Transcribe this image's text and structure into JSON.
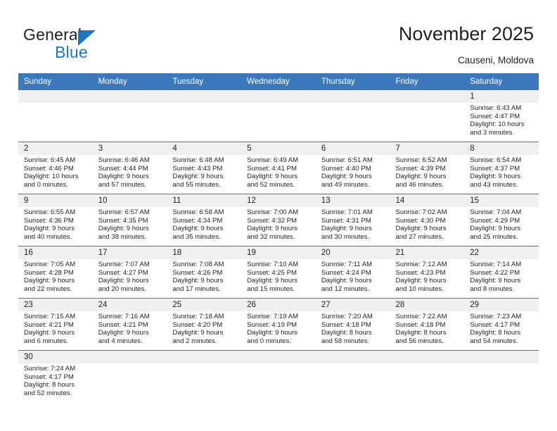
{
  "brand": {
    "name_part1": "General",
    "name_part2": "Blue",
    "accent_color": "#1f76bc"
  },
  "header": {
    "title": "November 2025",
    "subtitle": "Causeni, Moldova"
  },
  "calendar": {
    "header_bg": "#3b78bc",
    "daynum_bg": "#f0f0f0",
    "weekdays": [
      "Sunday",
      "Monday",
      "Tuesday",
      "Wednesday",
      "Thursday",
      "Friday",
      "Saturday"
    ],
    "weeks": [
      [
        {
          "blank": true
        },
        {
          "blank": true
        },
        {
          "blank": true
        },
        {
          "blank": true
        },
        {
          "blank": true
        },
        {
          "blank": true
        },
        {
          "day": "1",
          "sunrise": "Sunrise: 6:43 AM",
          "sunset": "Sunset: 4:47 PM",
          "daylight1": "Daylight: 10 hours",
          "daylight2": "and 3 minutes."
        }
      ],
      [
        {
          "day": "2",
          "sunrise": "Sunrise: 6:45 AM",
          "sunset": "Sunset: 4:46 PM",
          "daylight1": "Daylight: 10 hours",
          "daylight2": "and 0 minutes."
        },
        {
          "day": "3",
          "sunrise": "Sunrise: 6:46 AM",
          "sunset": "Sunset: 4:44 PM",
          "daylight1": "Daylight: 9 hours",
          "daylight2": "and 57 minutes."
        },
        {
          "day": "4",
          "sunrise": "Sunrise: 6:48 AM",
          "sunset": "Sunset: 4:43 PM",
          "daylight1": "Daylight: 9 hours",
          "daylight2": "and 55 minutes."
        },
        {
          "day": "5",
          "sunrise": "Sunrise: 6:49 AM",
          "sunset": "Sunset: 4:41 PM",
          "daylight1": "Daylight: 9 hours",
          "daylight2": "and 52 minutes."
        },
        {
          "day": "6",
          "sunrise": "Sunrise: 6:51 AM",
          "sunset": "Sunset: 4:40 PM",
          "daylight1": "Daylight: 9 hours",
          "daylight2": "and 49 minutes."
        },
        {
          "day": "7",
          "sunrise": "Sunrise: 6:52 AM",
          "sunset": "Sunset: 4:39 PM",
          "daylight1": "Daylight: 9 hours",
          "daylight2": "and 46 minutes."
        },
        {
          "day": "8",
          "sunrise": "Sunrise: 6:54 AM",
          "sunset": "Sunset: 4:37 PM",
          "daylight1": "Daylight: 9 hours",
          "daylight2": "and 43 minutes."
        }
      ],
      [
        {
          "day": "9",
          "sunrise": "Sunrise: 6:55 AM",
          "sunset": "Sunset: 4:36 PM",
          "daylight1": "Daylight: 9 hours",
          "daylight2": "and 40 minutes."
        },
        {
          "day": "10",
          "sunrise": "Sunrise: 6:57 AM",
          "sunset": "Sunset: 4:35 PM",
          "daylight1": "Daylight: 9 hours",
          "daylight2": "and 38 minutes."
        },
        {
          "day": "11",
          "sunrise": "Sunrise: 6:58 AM",
          "sunset": "Sunset: 4:34 PM",
          "daylight1": "Daylight: 9 hours",
          "daylight2": "and 35 minutes."
        },
        {
          "day": "12",
          "sunrise": "Sunrise: 7:00 AM",
          "sunset": "Sunset: 4:32 PM",
          "daylight1": "Daylight: 9 hours",
          "daylight2": "and 32 minutes."
        },
        {
          "day": "13",
          "sunrise": "Sunrise: 7:01 AM",
          "sunset": "Sunset: 4:31 PM",
          "daylight1": "Daylight: 9 hours",
          "daylight2": "and 30 minutes."
        },
        {
          "day": "14",
          "sunrise": "Sunrise: 7:02 AM",
          "sunset": "Sunset: 4:30 PM",
          "daylight1": "Daylight: 9 hours",
          "daylight2": "and 27 minutes."
        },
        {
          "day": "15",
          "sunrise": "Sunrise: 7:04 AM",
          "sunset": "Sunset: 4:29 PM",
          "daylight1": "Daylight: 9 hours",
          "daylight2": "and 25 minutes."
        }
      ],
      [
        {
          "day": "16",
          "sunrise": "Sunrise: 7:05 AM",
          "sunset": "Sunset: 4:28 PM",
          "daylight1": "Daylight: 9 hours",
          "daylight2": "and 22 minutes."
        },
        {
          "day": "17",
          "sunrise": "Sunrise: 7:07 AM",
          "sunset": "Sunset: 4:27 PM",
          "daylight1": "Daylight: 9 hours",
          "daylight2": "and 20 minutes."
        },
        {
          "day": "18",
          "sunrise": "Sunrise: 7:08 AM",
          "sunset": "Sunset: 4:26 PM",
          "daylight1": "Daylight: 9 hours",
          "daylight2": "and 17 minutes."
        },
        {
          "day": "19",
          "sunrise": "Sunrise: 7:10 AM",
          "sunset": "Sunset: 4:25 PM",
          "daylight1": "Daylight: 9 hours",
          "daylight2": "and 15 minutes."
        },
        {
          "day": "20",
          "sunrise": "Sunrise: 7:11 AM",
          "sunset": "Sunset: 4:24 PM",
          "daylight1": "Daylight: 9 hours",
          "daylight2": "and 12 minutes."
        },
        {
          "day": "21",
          "sunrise": "Sunrise: 7:12 AM",
          "sunset": "Sunset: 4:23 PM",
          "daylight1": "Daylight: 9 hours",
          "daylight2": "and 10 minutes."
        },
        {
          "day": "22",
          "sunrise": "Sunrise: 7:14 AM",
          "sunset": "Sunset: 4:22 PM",
          "daylight1": "Daylight: 9 hours",
          "daylight2": "and 8 minutes."
        }
      ],
      [
        {
          "day": "23",
          "sunrise": "Sunrise: 7:15 AM",
          "sunset": "Sunset: 4:21 PM",
          "daylight1": "Daylight: 9 hours",
          "daylight2": "and 6 minutes."
        },
        {
          "day": "24",
          "sunrise": "Sunrise: 7:16 AM",
          "sunset": "Sunset: 4:21 PM",
          "daylight1": "Daylight: 9 hours",
          "daylight2": "and 4 minutes."
        },
        {
          "day": "25",
          "sunrise": "Sunrise: 7:18 AM",
          "sunset": "Sunset: 4:20 PM",
          "daylight1": "Daylight: 9 hours",
          "daylight2": "and 2 minutes."
        },
        {
          "day": "26",
          "sunrise": "Sunrise: 7:19 AM",
          "sunset": "Sunset: 4:19 PM",
          "daylight1": "Daylight: 9 hours",
          "daylight2": "and 0 minutes."
        },
        {
          "day": "27",
          "sunrise": "Sunrise: 7:20 AM",
          "sunset": "Sunset: 4:18 PM",
          "daylight1": "Daylight: 8 hours",
          "daylight2": "and 58 minutes."
        },
        {
          "day": "28",
          "sunrise": "Sunrise: 7:22 AM",
          "sunset": "Sunset: 4:18 PM",
          "daylight1": "Daylight: 8 hours",
          "daylight2": "and 56 minutes."
        },
        {
          "day": "29",
          "sunrise": "Sunrise: 7:23 AM",
          "sunset": "Sunset: 4:17 PM",
          "daylight1": "Daylight: 8 hours",
          "daylight2": "and 54 minutes."
        }
      ],
      [
        {
          "day": "30",
          "sunrise": "Sunrise: 7:24 AM",
          "sunset": "Sunset: 4:17 PM",
          "daylight1": "Daylight: 8 hours",
          "daylight2": "and 52 minutes."
        },
        {
          "blank": true
        },
        {
          "blank": true
        },
        {
          "blank": true
        },
        {
          "blank": true
        },
        {
          "blank": true
        },
        {
          "blank": true
        }
      ]
    ]
  }
}
